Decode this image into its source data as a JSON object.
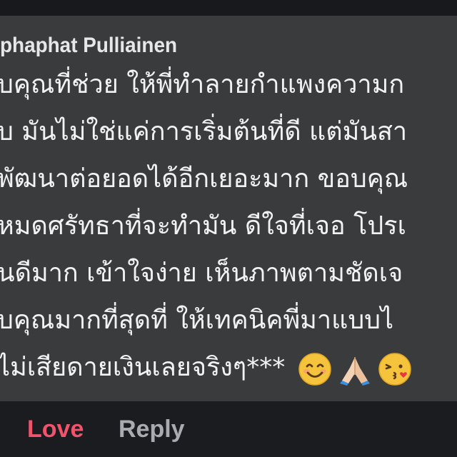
{
  "comment": {
    "author": "phaphat Pulliainen",
    "lines": [
      "บคุณที่ช่วย ให้พี่ทำลายกำแพงความก",
      "บ มันไม่ใช่แค่การเริ่มต้นที่ดี แต่มันสา",
      "พัฒนาต่อยอดได้อีกเยอะมาก ขอบคุณ",
      "หมดศรัทธาที่จะทำมัน ดีใจที่เจอ โปรเ",
      "นดีมาก เข้าใจง่าย เห็นภาพตามชัดเจ",
      "บคุณมากที่สุดที่ ให้เทคนิคพี่มาแบบไ",
      "ไม่เสียดายเงินเลยจริงๆ***"
    ],
    "emojis": [
      "smiling-face",
      "folded-hands",
      "face-blowing-kiss"
    ]
  },
  "actions": {
    "love_label": "Love",
    "reply_label": "Reply"
  },
  "colors": {
    "background": "#1b1c1f",
    "bubble": "#3a3b3d",
    "text": "#f1f2f4",
    "love": "#f0546c",
    "reply": "#a9abb0"
  }
}
